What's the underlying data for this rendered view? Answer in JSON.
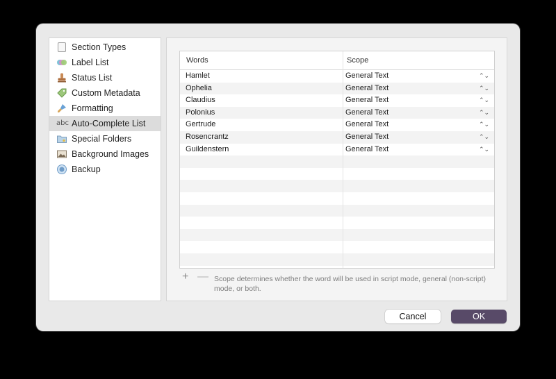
{
  "sidebar": {
    "items": [
      {
        "label": "Section Types",
        "icon": "page-icon"
      },
      {
        "label": "Label List",
        "icon": "label-dots-icon"
      },
      {
        "label": "Status List",
        "icon": "stamp-icon"
      },
      {
        "label": "Custom Metadata",
        "icon": "tag-icon"
      },
      {
        "label": "Formatting",
        "icon": "brush-icon"
      },
      {
        "label": "Auto-Complete List",
        "icon": "abc-icon",
        "icon_text": "abc",
        "selected": true
      },
      {
        "label": "Special Folders",
        "icon": "folder-star-icon"
      },
      {
        "label": "Background Images",
        "icon": "image-icon"
      },
      {
        "label": "Backup",
        "icon": "backup-icon"
      }
    ]
  },
  "table": {
    "headers": {
      "words": "Words",
      "scope": "Scope"
    },
    "rows": [
      {
        "word": "Hamlet",
        "scope": "General Text"
      },
      {
        "word": "Ophelia",
        "scope": "General Text"
      },
      {
        "word": "Claudius",
        "scope": "General Text"
      },
      {
        "word": "Polonius",
        "scope": "General Text"
      },
      {
        "word": "Gertrude",
        "scope": "General Text"
      },
      {
        "word": "Rosencrantz",
        "scope": "General Text"
      },
      {
        "word": "Guildenstern",
        "scope": "General Text"
      }
    ],
    "stepper_glyph": "⌃⌄"
  },
  "controls": {
    "add_glyph": "+",
    "remove_glyph": "—",
    "hint": "Scope determines whether the word will be used in script mode, general (non-script) mode, or both."
  },
  "buttons": {
    "cancel": "Cancel",
    "ok": "OK"
  },
  "colors": {
    "ok_button": "#584a68",
    "selected_item": "#dcdcdc",
    "dialog_bg": "#e9e9e9"
  }
}
